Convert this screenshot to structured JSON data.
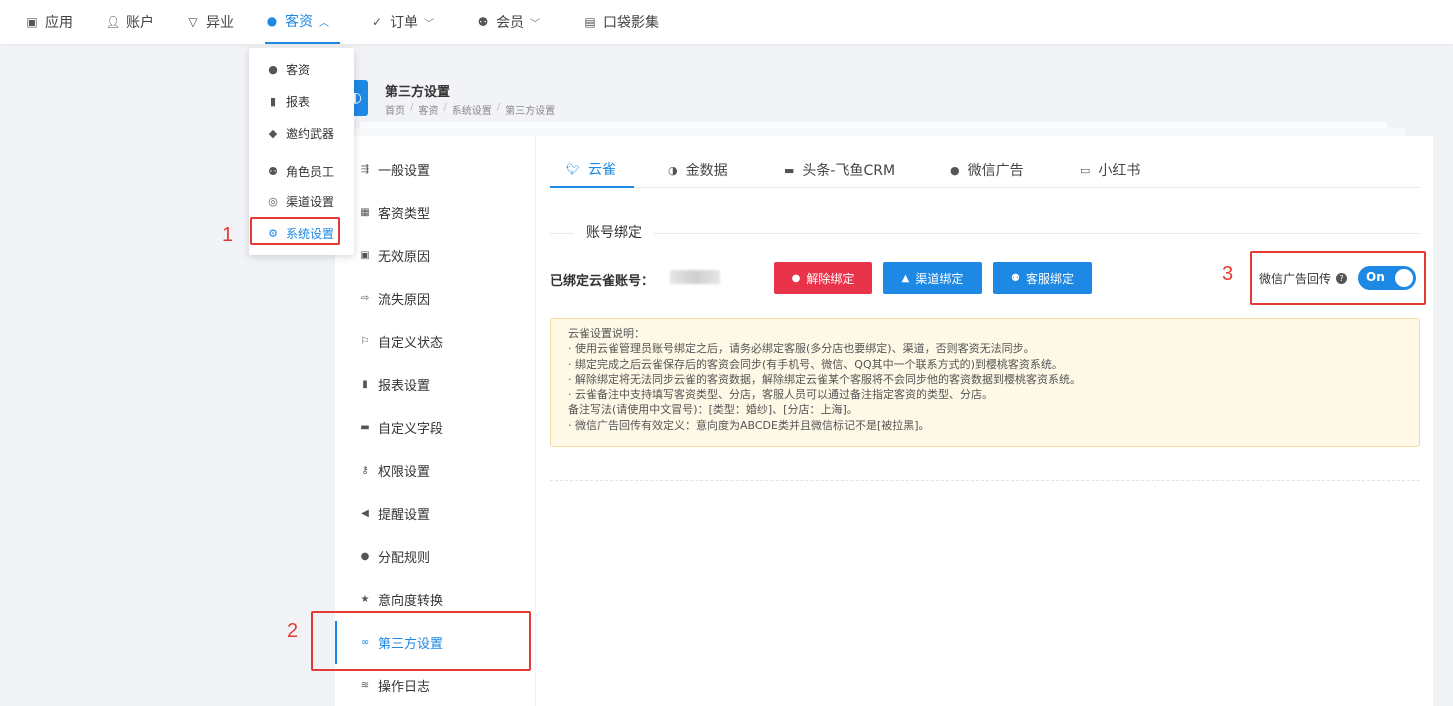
{
  "topnav": {
    "items": [
      {
        "label": "应用",
        "icon": "briefcase-icon"
      },
      {
        "label": "账户",
        "icon": "user-icon"
      },
      {
        "label": "异业",
        "icon": "cup-icon"
      },
      {
        "label": "客资",
        "icon": "customer-icon",
        "active": true
      },
      {
        "label": "订单",
        "icon": "check-circle-icon"
      },
      {
        "label": "会员",
        "icon": "users-icon"
      },
      {
        "label": "口袋影集",
        "icon": "album-icon"
      }
    ]
  },
  "dropdown": {
    "items": [
      {
        "label": "客资",
        "icon": "customer-icon"
      },
      {
        "label": "报表",
        "icon": "bar-chart-icon"
      },
      {
        "label": "邀约武器",
        "icon": "android-icon"
      },
      {
        "label": "角色员工",
        "icon": "users-icon"
      },
      {
        "label": "渠道设置",
        "icon": "globe-icon"
      },
      {
        "label": "系统设置",
        "icon": "gear-icon",
        "active": true
      }
    ]
  },
  "annotations": {
    "one": "1",
    "two": "2",
    "three": "3"
  },
  "page_header": {
    "title": "第三方设置",
    "breadcrumb": [
      "首页",
      "客资",
      "系统设置",
      "第三方设置"
    ]
  },
  "sidemenu": {
    "items": [
      {
        "label": "一般设置",
        "icon": "sliders-icon"
      },
      {
        "label": "客资类型",
        "icon": "grid-icon"
      },
      {
        "label": "无效原因",
        "icon": "archive-icon"
      },
      {
        "label": "流失原因",
        "icon": "sign-out-icon"
      },
      {
        "label": "自定义状态",
        "icon": "flag-icon"
      },
      {
        "label": "报表设置",
        "icon": "bar-chart-icon"
      },
      {
        "label": "自定义字段",
        "icon": "book-icon"
      },
      {
        "label": "权限设置",
        "icon": "key-icon"
      },
      {
        "label": "提醒设置",
        "icon": "bullhorn-icon"
      },
      {
        "label": "分配规则",
        "icon": "customer-icon"
      },
      {
        "label": "意向度转换",
        "icon": "star-icon"
      },
      {
        "label": "第三方设置",
        "icon": "link-icon",
        "active": true
      },
      {
        "label": "操作日志",
        "icon": "layers-icon"
      }
    ]
  },
  "tabs": [
    {
      "label": "云雀",
      "icon": "bird-icon",
      "active": true
    },
    {
      "label": "金数据",
      "icon": "pie-icon"
    },
    {
      "label": "头条-飞鱼CRM",
      "icon": "briefcase-icon"
    },
    {
      "label": "微信广告",
      "icon": "chat-icon"
    },
    {
      "label": "小红书",
      "icon": "card-icon"
    }
  ],
  "binding": {
    "section_title": "账号绑定",
    "bound_label": "已绑定云雀账号：",
    "unbind_label": "解除绑定",
    "channel_bind_label": "渠道绑定",
    "service_bind_label": "客服绑定",
    "toggle_label": "微信广告回传",
    "toggle_value": "On",
    "accent_blue": "#1e88e5",
    "accent_red": "#e8334a"
  },
  "notice": {
    "lines": [
      "云雀设置说明：",
      "· 使用云雀管理员账号绑定之后，请务必绑定客服(多分店也要绑定)、渠道，否则客资无法同步。",
      "· 绑定完成之后云雀保存后的客资会同步(有手机号、微信、QQ其中一个联系方式的)到樱桃客资系统。",
      "· 解除绑定将无法同步云雀的客资数据，解除绑定云雀某个客服将不会同步他的客资数据到樱桃客资系统。",
      "· 云雀备注中支持填写客资类型、分店，客服人员可以通过备注指定客资的类型、分店。",
      "备注写法(请使用中文冒号)：[类型：婚纱]、[分店：上海]。",
      "· 微信广告回传有效定义：意向度为ABCDE类并且微信标记不是[被拉黑]。"
    ]
  }
}
